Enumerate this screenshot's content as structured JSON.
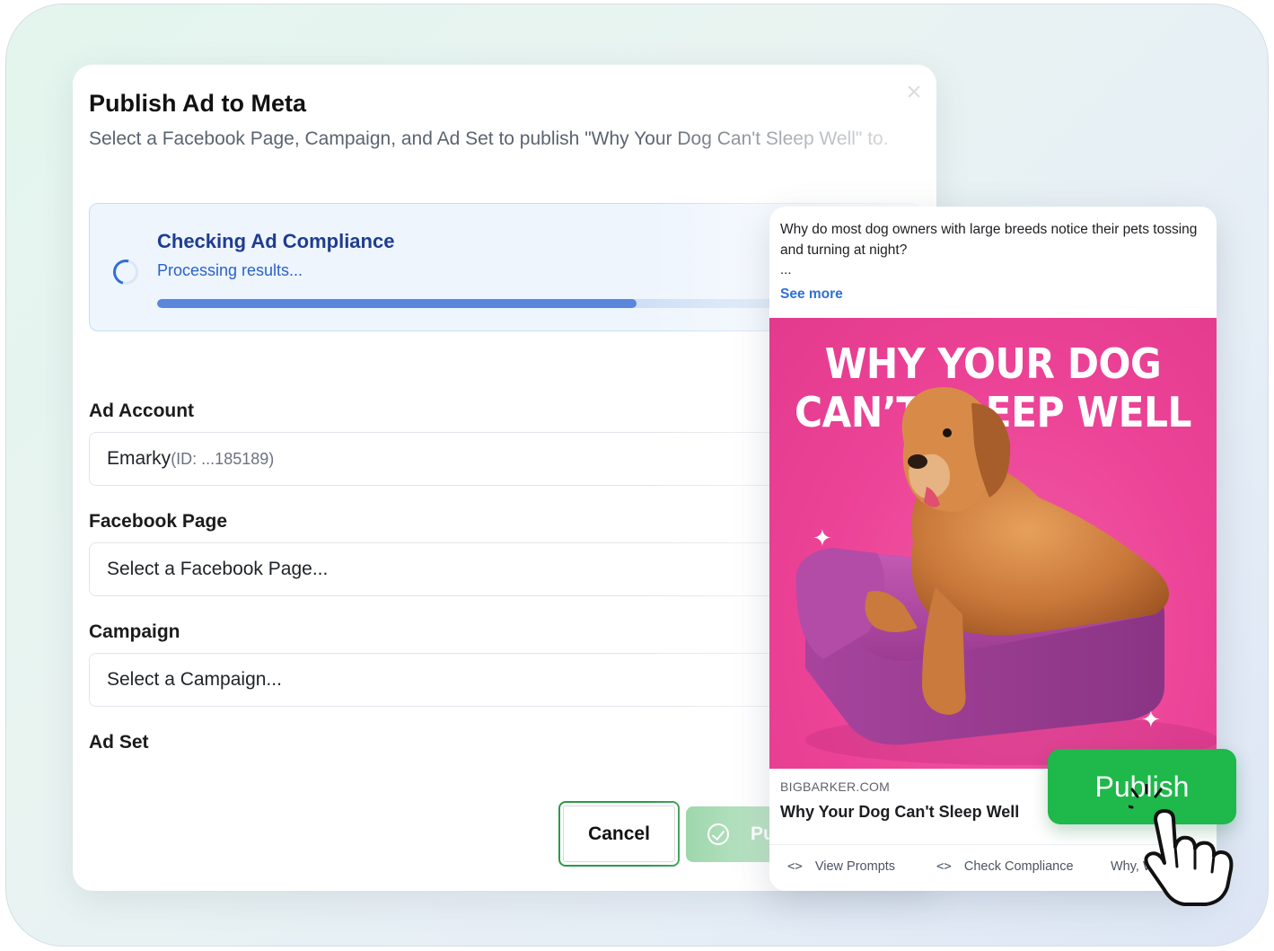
{
  "modal": {
    "title": "Publish Ad to Meta",
    "subtitle": "Select a Facebook Page, Campaign, and Ad Set to publish \"Why Your Dog Can't Sleep Well\" to.",
    "close_glyph": "×"
  },
  "compliance": {
    "title": "Checking Ad Compliance",
    "status": "Processing results...",
    "progress": 0.64
  },
  "fields": {
    "ad_account": {
      "label": "Ad Account",
      "value": "Emarky",
      "id_text": "(ID: ...185189)"
    },
    "facebook_page": {
      "label": "Facebook Page",
      "placeholder": "Select a Facebook Page..."
    },
    "campaign": {
      "label": "Campaign",
      "placeholder": "Select a Campaign..."
    },
    "ad_set": {
      "label": "Ad Set"
    }
  },
  "buttons": {
    "cancel": "Cancel",
    "publish_partial": "Pu",
    "publish": "Publish"
  },
  "ad_preview": {
    "primary_text": "Why do most dog owners with large breeds notice their pets tossing and turning at night?",
    "ellipsis": "...",
    "see_more": "See more",
    "headline_line1": "WHY YOUR DOG",
    "headline_line2": "CAN’T SLEEP WELL",
    "domain": "BIGBARKER.COM",
    "title": "Why Your Dog Can't Sleep Well",
    "actions": [
      "View Prompts",
      "Check Compliance",
      "Why, Wh"
    ]
  },
  "colors": {
    "accent_green": "#1fb84a",
    "creative_pink": "#ec4397",
    "compliance_blue": "#2a62c9"
  },
  "icons": [
    "close-icon",
    "spinner-icon",
    "check-circle-icon",
    "code-icon",
    "sparkle-icon",
    "hand-pointer-icon"
  ]
}
